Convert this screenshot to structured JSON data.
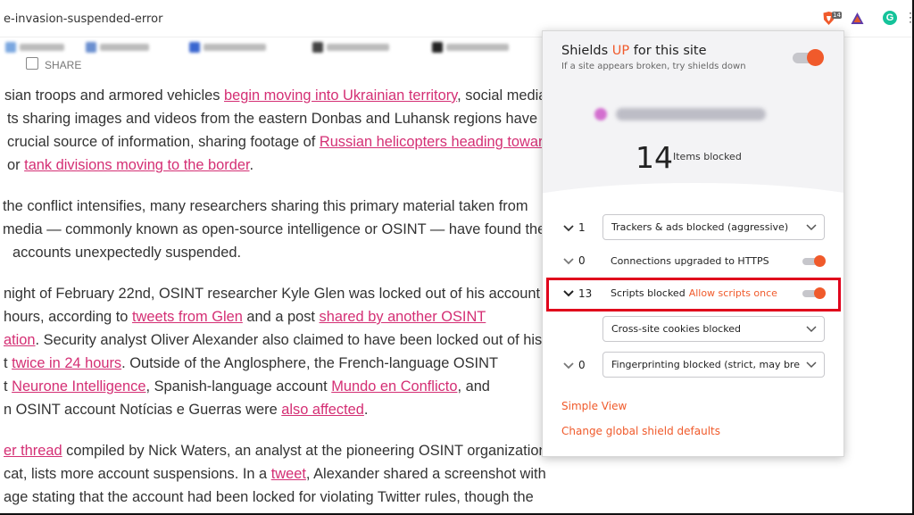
{
  "browser": {
    "url": "e-invasion-suspended-error",
    "brave_badge": "14"
  },
  "article": {
    "share_label": "SHARE",
    "paragraphs": [
      [
        [
          {
            "t": "sian troops and armored vehicles "
          },
          {
            "t": "begin moving into Ukrainian territory",
            "link": true
          },
          {
            "t": ", social media"
          }
        ],
        [
          {
            "t": "ts sharing images and videos from the eastern Donbas and Luhansk regions have"
          }
        ],
        [
          {
            "t": " crucial source of information, sharing footage of "
          },
          {
            "t": "Russian helicopters heading towar",
            "link": true
          }
        ],
        [
          {
            "t": " or "
          },
          {
            "t": "tank divisions moving to the border",
            "link": true
          },
          {
            "t": "."
          }
        ]
      ],
      [
        [
          {
            "t": "the conflict intensifies, many researchers sharing this primary material taken from"
          }
        ],
        [
          {
            "t": "media — commonly known as open-source intelligence or OSINT — have found the"
          }
        ],
        [
          {
            "t": "accounts unexpectedly suspended."
          }
        ]
      ],
      [
        [
          {
            "t": "night of February 22nd, OSINT researcher Kyle Glen was locked out of his account"
          }
        ],
        [
          {
            "t": "hours, according to "
          },
          {
            "t": "tweets from Glen",
            "link": true
          },
          {
            "t": " and a post "
          },
          {
            "t": "shared by another OSINT",
            "link": true
          }
        ],
        [
          {
            "t": "ation",
            "link": true
          },
          {
            "t": ". Security analyst Oliver Alexander also claimed to have been locked out of his"
          }
        ],
        [
          {
            "t": "t "
          },
          {
            "t": "twice in 24 hours",
            "link": true
          },
          {
            "t": ". Outside of the Anglosphere, the French-language OSINT"
          }
        ],
        [
          {
            "t": "t "
          },
          {
            "t": "Neurone Intelligence",
            "link": true
          },
          {
            "t": ", Spanish-language account "
          },
          {
            "t": "Mundo en Conflicto",
            "link": true
          },
          {
            "t": ", and"
          }
        ],
        [
          {
            "t": "n OSINT account Notícias e Guerras were "
          },
          {
            "t": "also affected",
            "link": true
          },
          {
            "t": "."
          }
        ]
      ],
      [
        [
          {
            "t": "er thread",
            "link": true
          },
          {
            "t": " compiled by Nick Waters, an analyst at the pioneering OSINT organization"
          }
        ],
        [
          {
            "t": "cat, lists more account suspensions. In a "
          },
          {
            "t": "tweet",
            "link": true
          },
          {
            "t": ", Alexander shared a screenshot with"
          }
        ],
        [
          {
            "t": "age stating that the account had been locked for violating Twitter rules, though the"
          }
        ]
      ]
    ]
  },
  "shields": {
    "title_pre": "Shields ",
    "title_up": "UP",
    "title_post": " for this site",
    "subtitle": "If a site appears broken, try shields down",
    "items_blocked_count": "14",
    "items_blocked_label": "Items blocked",
    "rows": {
      "trackers": {
        "count": "1",
        "label": "Trackers & ads blocked (aggressive)"
      },
      "https": {
        "count": "0",
        "label": "Connections upgraded to HTTPS"
      },
      "scripts": {
        "count": "13",
        "label": "Scripts blocked",
        "action": "Allow scripts once"
      },
      "cookies": {
        "label": "Cross-site cookies blocked"
      },
      "fingerprinting": {
        "count": "0",
        "label": "Fingerprinting blocked (strict, may bre"
      }
    },
    "simple_view": "Simple View",
    "global_defaults": "Change global shield defaults"
  },
  "colors": {
    "link": "#d42f74",
    "brave_orange": "#f05a2b",
    "highlight_red": "#e0001b"
  }
}
